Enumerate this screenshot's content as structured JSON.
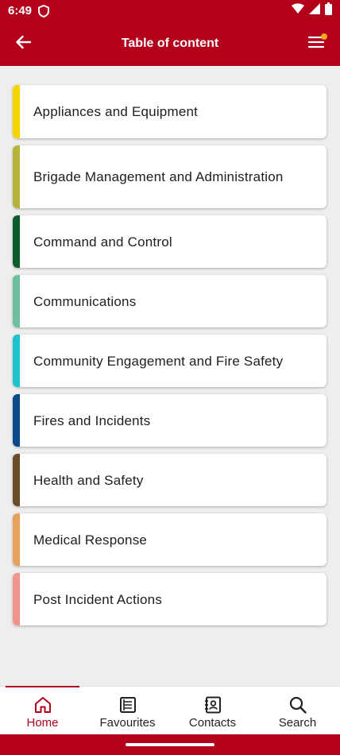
{
  "status_bar": {
    "time": "6:49"
  },
  "app_bar": {
    "title": "Table of content"
  },
  "colors": {
    "primary": "#b3001b",
    "badge": "#f5a623"
  },
  "sections": [
    {
      "label": "Appliances and Equipment",
      "color": "#f5d400"
    },
    {
      "label": "Brigade Management and Administration",
      "color": "#b5b33a"
    },
    {
      "label": "Command and Control",
      "color": "#0d5c2a"
    },
    {
      "label": "Communications",
      "color": "#6cc0a0"
    },
    {
      "label": "Community Engagement and Fire Safety",
      "color": "#1fc2cf"
    },
    {
      "label": "Fires and Incidents",
      "color": "#0a4a8a"
    },
    {
      "label": "Health and Safety",
      "color": "#6b4b2a"
    },
    {
      "label": "Medical Response",
      "color": "#e8a15a"
    },
    {
      "label": "Post Incident Actions",
      "color": "#f2948a"
    }
  ],
  "bottom_nav": [
    {
      "label": "Home",
      "icon": "home-icon",
      "active": true
    },
    {
      "label": "Favourites",
      "icon": "favourites-icon",
      "active": false
    },
    {
      "label": "Contacts",
      "icon": "contacts-icon",
      "active": false
    },
    {
      "label": "Search",
      "icon": "search-icon",
      "active": false
    }
  ]
}
